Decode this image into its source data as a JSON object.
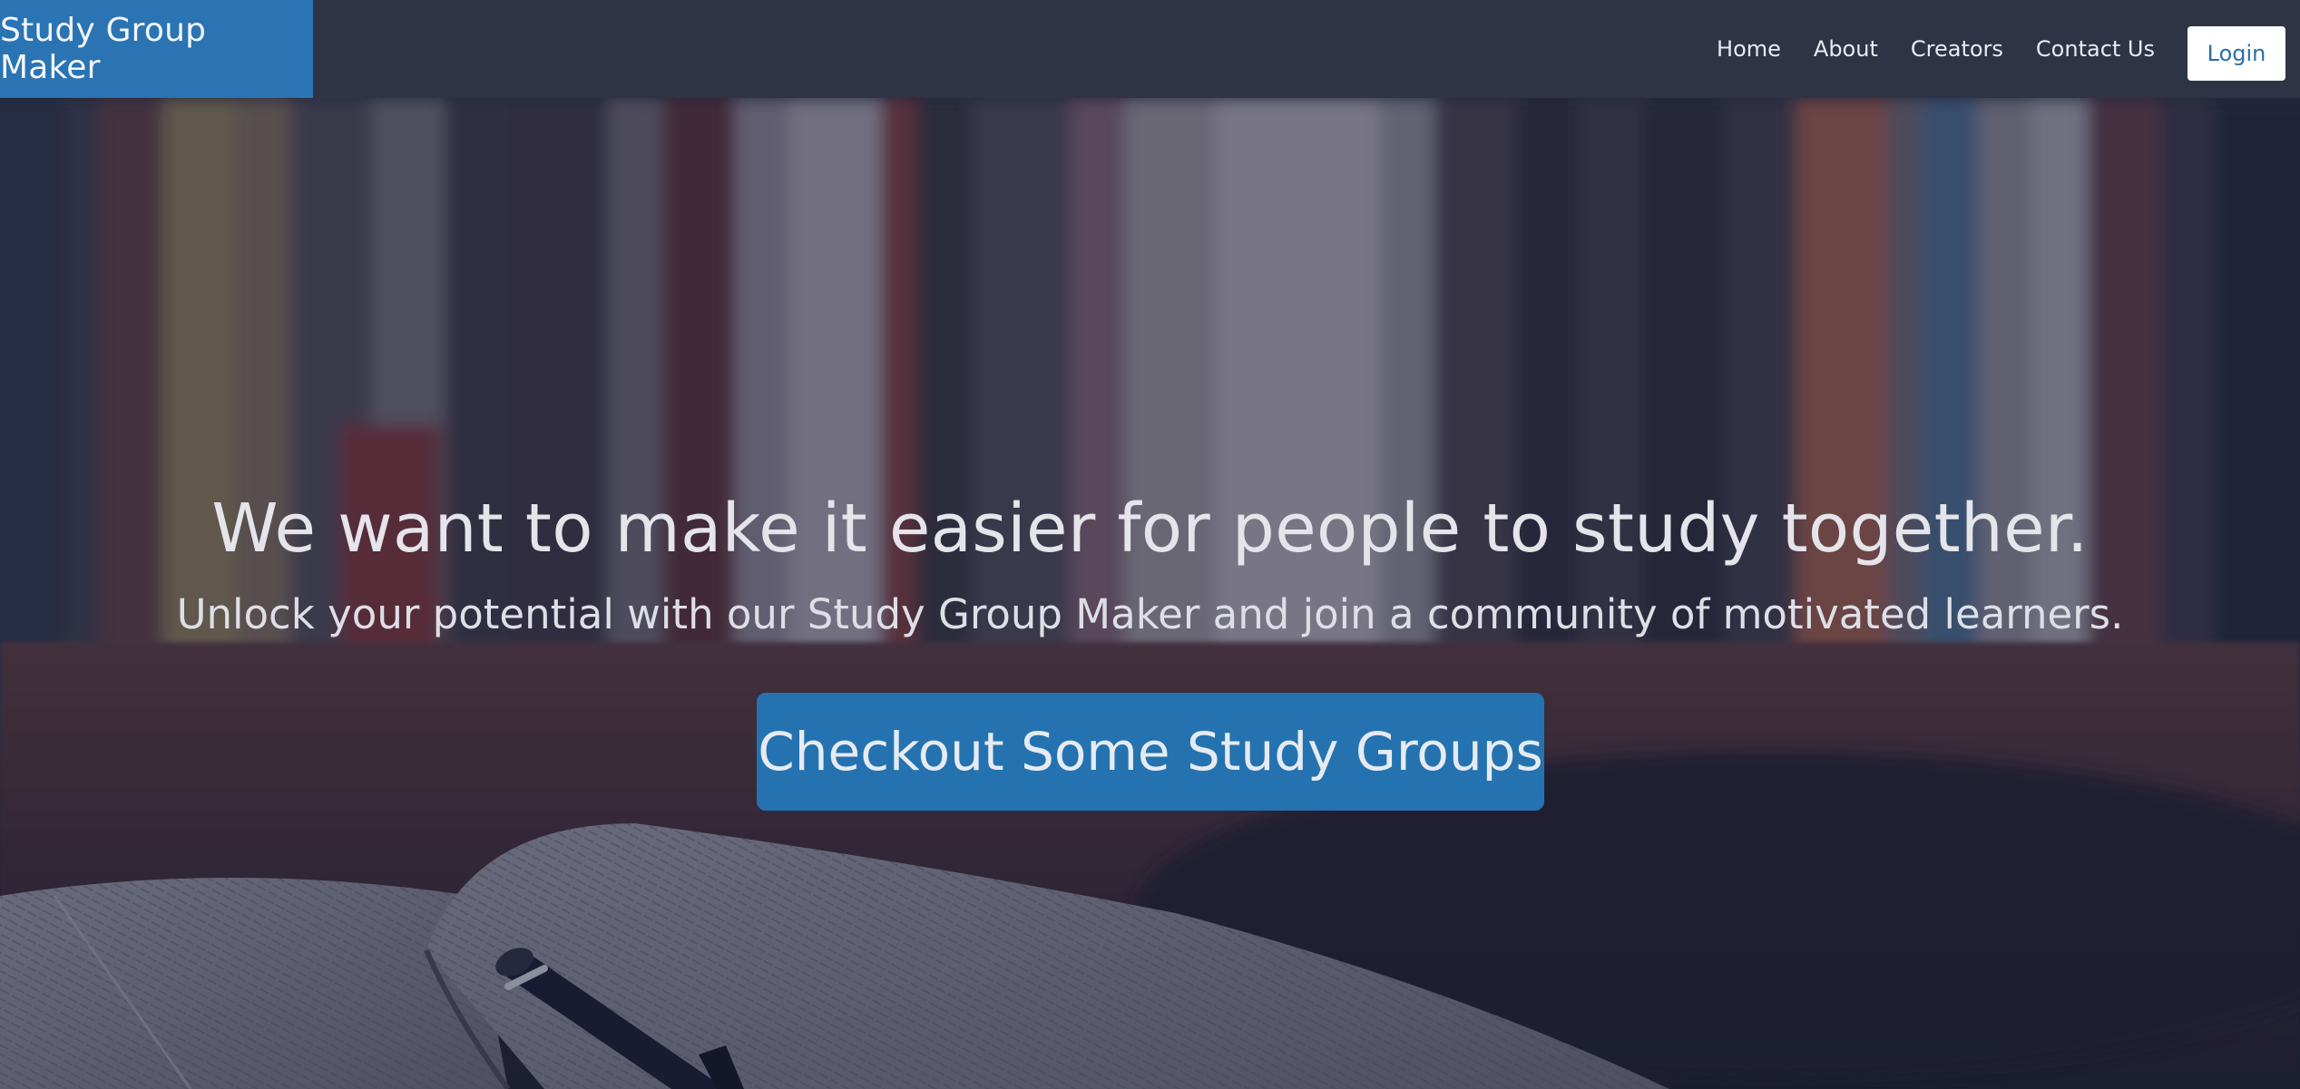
{
  "navbar": {
    "brand": "Study Group Maker",
    "links": [
      "Home",
      "About",
      "Creators",
      "Contact Us"
    ],
    "login_label": "Login"
  },
  "hero": {
    "title": "We want to make it easier for people to study together.",
    "subtitle": "Unlock your potential with our Study Group Maker and join a community of motivated learners.",
    "cta_label": "Checkout Some Study Groups"
  },
  "colors": {
    "navbar_bg": "#2e3346",
    "brand_bg": "#2a74b3",
    "cta_bg": "#2473b0",
    "login_text": "#2a6fa8"
  }
}
